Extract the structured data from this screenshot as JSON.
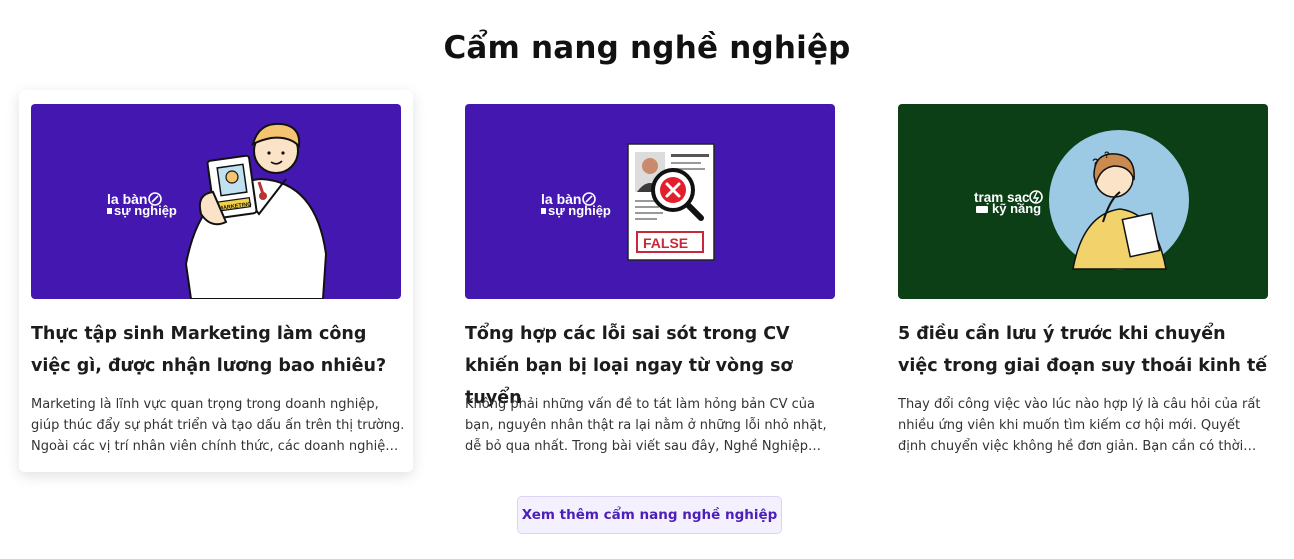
{
  "section": {
    "title": "Cẩm nang nghề nghiệp"
  },
  "cards": [
    {
      "brand_line1": "la bàn",
      "brand_line2": "sự nghiệp",
      "badge_text": "MARKETING",
      "thumb_bg": "#4418b0",
      "title": "Thực tập sinh Marketing làm công việc gì, được nhận lương bao nhiêu?",
      "excerpt": "Marketing là lĩnh vực quan trọng trong doanh nghiệp, giúp thúc đẩy sự phát triển và tạo dấu ấn trên thị trường. Ngoài các vị trí nhân viên chính thức, các doanh nghiệp thường tuyển dụng thực tập sinh Marketing."
    },
    {
      "brand_line1": "la bàn",
      "brand_line2": "sự nghiệp",
      "stamp_text": "FALSE",
      "thumb_bg": "#4418b0",
      "title": "Tổng hợp các lỗi sai sót trong CV khiến bạn bị loại ngay từ vòng sơ tuyển",
      "excerpt": "Không phải những vấn đề to tát làm hỏng bản CV của bạn, nguyên nhân thật ra lại nằm ở những lỗi nhỏ nhặt, dễ bỏ qua nhất. Trong bài viết sau đây, Nghề Nghiệp Việc Làm sẽ tổng hợp các lỗi sai."
    },
    {
      "brand_line1": "trạm sạc",
      "brand_line2": "kỹ năng",
      "thumb_bg": "#0d3f17",
      "title": "5 điều cần lưu ý trước khi chuyển việc trong giai đoạn suy thoái kinh tế",
      "excerpt": "Thay đổi công việc vào lúc nào hợp lý là câu hỏi của rất nhiều ứng viên khi muốn tìm kiếm cơ hội mới. Quyết định chuyển việc không hề đơn giản. Bạn cần có thời gian để cân nhắc."
    }
  ],
  "more_button": {
    "label": "Xem thêm cẩm nang nghề nghiệp"
  },
  "colors": {
    "accent": "#4b1fb8",
    "button_bg": "#f4f0fd",
    "purple_thumb": "#4418b0",
    "green_thumb": "#0d3f17"
  }
}
